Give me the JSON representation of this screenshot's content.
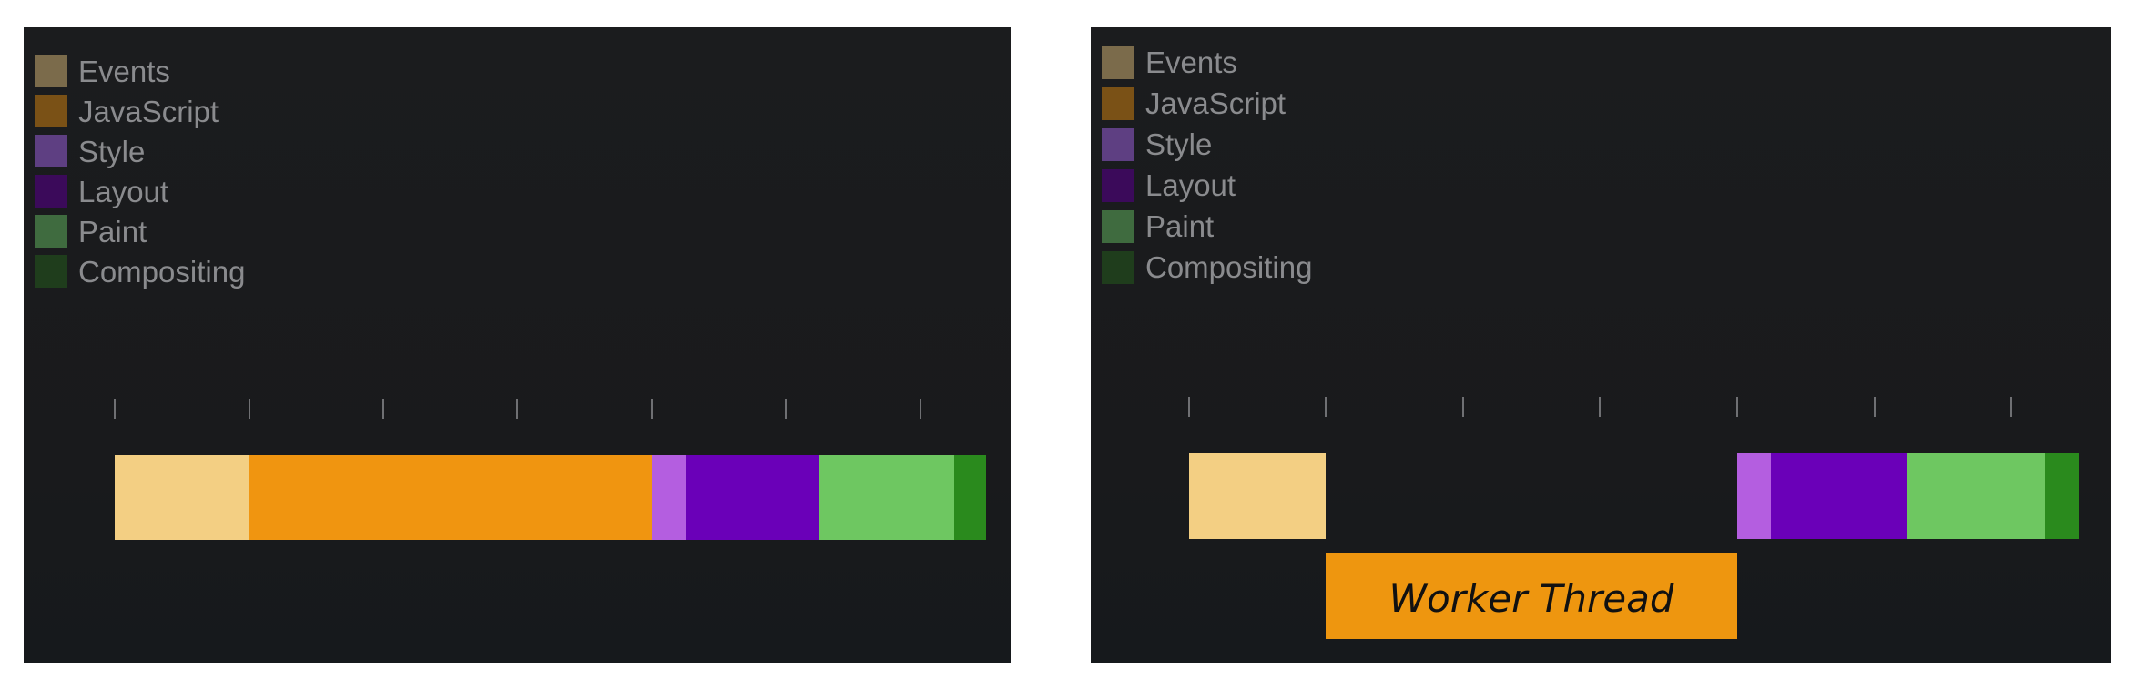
{
  "legend": [
    {
      "label": "Events",
      "color": "#7b6b4b"
    },
    {
      "label": "JavaScript",
      "color": "#7a5116"
    },
    {
      "label": "Style",
      "color": "#5e3f82"
    },
    {
      "label": "Layout",
      "color": "#3b0a5a"
    },
    {
      "label": "Paint",
      "color": "#3f6b3f"
    },
    {
      "label": "Compositing",
      "color": "#1f3d1c"
    }
  ],
  "main_thread_colors": {
    "events": "#f3cf83",
    "javascript": "#f09510",
    "style": "#b45ee0",
    "layout": "#6a00b8",
    "paint": "#6ec761",
    "compositing": "#2a8a1d"
  },
  "worker": {
    "label": "Worker Thread",
    "color": "#ee960f"
  }
}
